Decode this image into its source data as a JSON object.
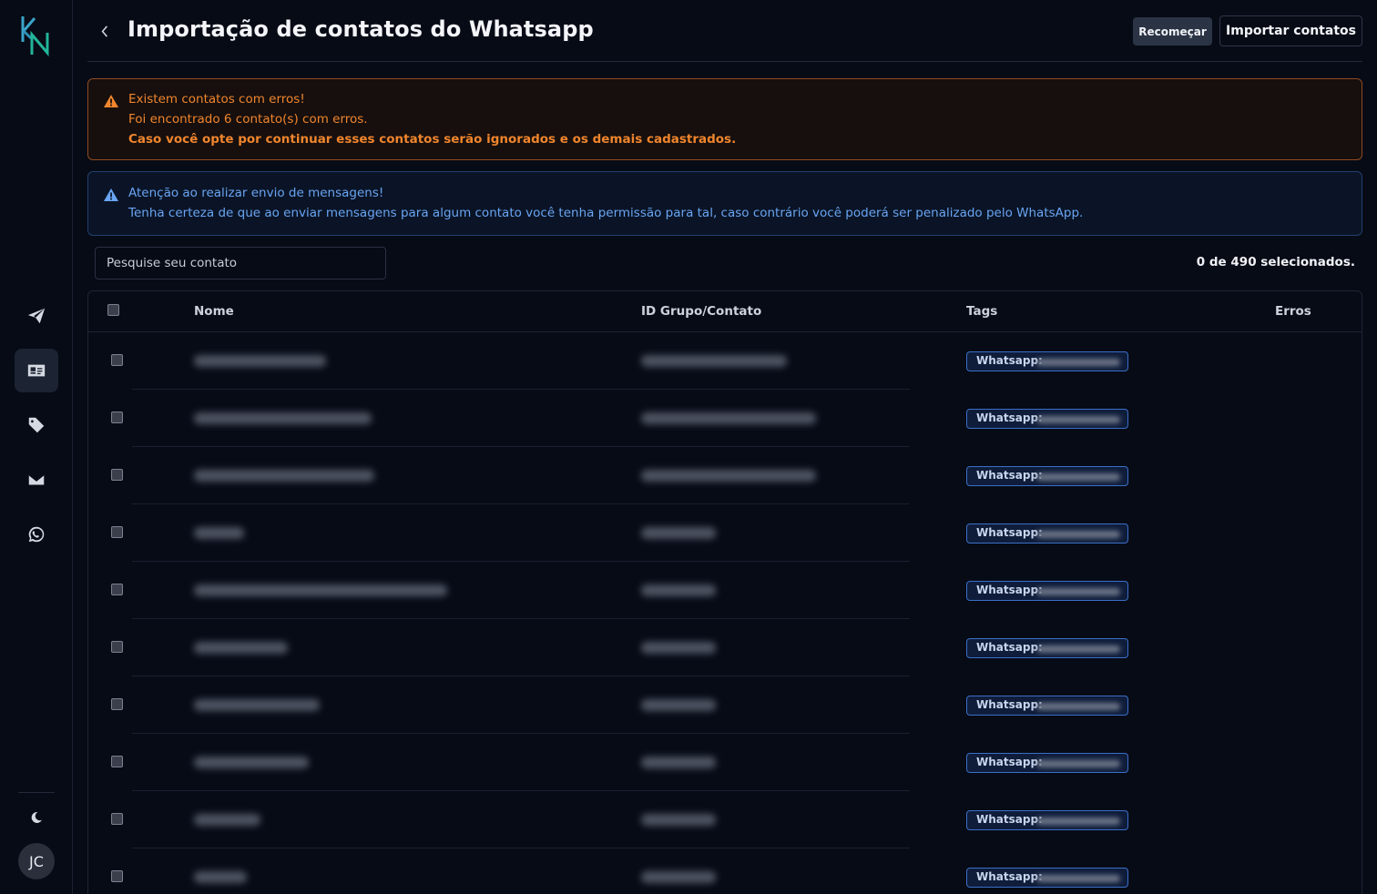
{
  "header": {
    "title": "Importação de contatos do Whatsapp",
    "restart_label": "Recomeçar",
    "import_label": "Importar contatos"
  },
  "alerts": {
    "warning": {
      "title": "Existem contatos com erros!",
      "line1": "Foi encontrado 6 contato(s) com erros.",
      "line2": "Caso você opte por continuar esses contatos serão ignorados e os demais cadastrados."
    },
    "info": {
      "title": "Atenção ao realizar envio de mensagens!",
      "line1": "Tenha certeza de que ao enviar mensagens para algum contato você tenha permissão para tal, caso contrário você poderá ser penalizado pelo WhatsApp."
    }
  },
  "search": {
    "placeholder": "Pesquise seu contato"
  },
  "selection": {
    "count_text": "0 de 490 selecionados."
  },
  "table": {
    "columns": [
      "Nome",
      "ID Grupo/Contato",
      "Tags",
      "Erros"
    ],
    "tag_label": "Whatsapp:",
    "row_count": 10
  },
  "user": {
    "initials": "JC"
  },
  "colors": {
    "background": "#070b16",
    "warning": "#f0852d",
    "info": "#69a4f2",
    "tag_border": "#3b6fc7"
  },
  "icons": {
    "sidebar": [
      "send-icon",
      "contacts-icon",
      "tags-icon",
      "mail-icon",
      "whatsapp-icon"
    ],
    "theme": "moon-icon"
  }
}
